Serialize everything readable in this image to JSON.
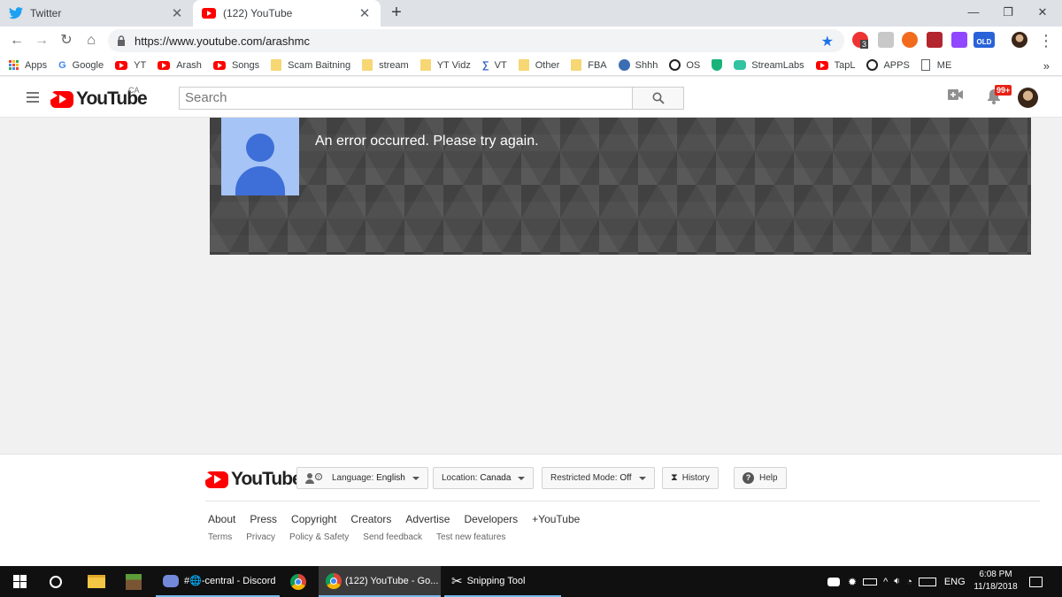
{
  "browser": {
    "tabs": [
      {
        "title": "Twitter",
        "icon": "twitter-bird-icon",
        "active": false
      },
      {
        "title": "(122) YouTube",
        "icon": "youtube-favicon",
        "active": true
      }
    ],
    "url": "https://www.youtube.com/arashmc",
    "bookmarks": [
      {
        "label": "Apps",
        "icon": "apps-grid-icon"
      },
      {
        "label": "Google",
        "icon": "google-icon"
      },
      {
        "label": "YT",
        "icon": "youtube-icon"
      },
      {
        "label": "Arash",
        "icon": "youtube-icon"
      },
      {
        "label": "Songs",
        "icon": "youtube-icon"
      },
      {
        "label": "Scam Baitning",
        "icon": "folder-icon"
      },
      {
        "label": "stream",
        "icon": "folder-icon"
      },
      {
        "label": "YT Vidz",
        "icon": "folder-icon"
      },
      {
        "label": "VT",
        "icon": "vt-icon"
      },
      {
        "label": "Other",
        "icon": "folder-icon"
      },
      {
        "label": "FBA",
        "icon": "folder-icon"
      },
      {
        "label": "Shhh",
        "icon": "globe-icon"
      },
      {
        "label": "OS",
        "icon": "e-icon"
      },
      {
        "label": "",
        "icon": "shield-icon"
      },
      {
        "label": "StreamLabs",
        "icon": "streamlabs-icon"
      },
      {
        "label": "TapL",
        "icon": "youtube-icon"
      },
      {
        "label": "APPS",
        "icon": "e-icon"
      },
      {
        "label": "ME",
        "icon": "page-icon"
      }
    ],
    "extension_badge": "3",
    "old_badge": "OLD"
  },
  "youtube": {
    "country": "CA",
    "search_placeholder": "Search",
    "notification_count": "99+",
    "error_message": "An error occurred. Please try again.",
    "footer": {
      "language_label": "Language:",
      "language_value": "English",
      "location_label": "Location:",
      "location_value": "Canada",
      "restricted_label": "Restricted Mode:",
      "restricted_value": "Off",
      "history_label": "History",
      "help_label": "Help",
      "links_primary": [
        "About",
        "Press",
        "Copyright",
        "Creators",
        "Advertise",
        "Developers",
        "+YouTube"
      ],
      "links_secondary": [
        "Terms",
        "Privacy",
        "Policy & Safety",
        "Send feedback",
        "Test new features"
      ]
    }
  },
  "taskbar": {
    "items": [
      {
        "label": "#🌐-central - Discord",
        "icon": "discord-icon"
      },
      {
        "label": "(122) YouTube - Go...",
        "icon": "chrome-icon"
      },
      {
        "label": "Snipping Tool",
        "icon": "scissors-icon"
      }
    ],
    "language": "ENG",
    "time": "6:08 PM",
    "date": "11/18/2018"
  },
  "colors": {
    "youtube_red": "#ff0000",
    "chrome_blue": "#1a73e8",
    "taskbar_bg": "#101010",
    "banner_bg": "#4a4a4a"
  }
}
